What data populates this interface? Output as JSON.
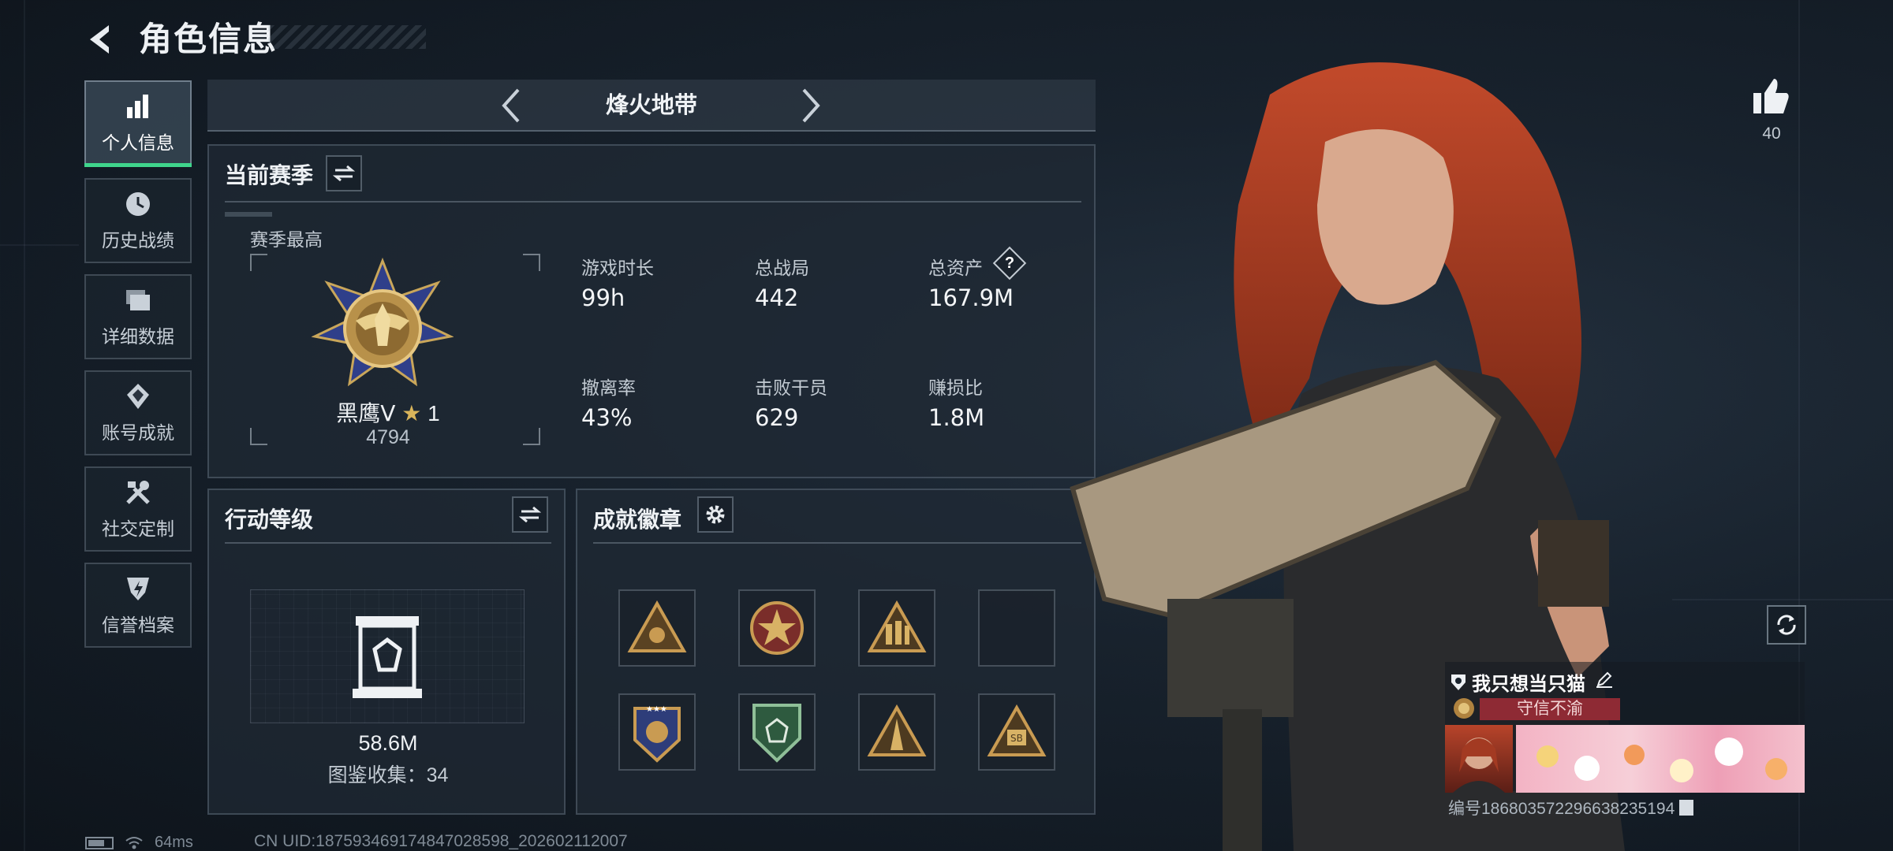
{
  "header": {
    "title": "角色信息"
  },
  "sidebar": {
    "items": [
      {
        "label": "个人信息",
        "icon": "bar-chart-icon",
        "active": true
      },
      {
        "label": "历史战绩",
        "icon": "history-clock-icon"
      },
      {
        "label": "详细数据",
        "icon": "stacked-cards-icon"
      },
      {
        "label": "账号成就",
        "icon": "achievement-ribbon-icon"
      },
      {
        "label": "社交定制",
        "icon": "tools-icon"
      },
      {
        "label": "信誉档案",
        "icon": "shield-lightning-icon"
      }
    ]
  },
  "mode": {
    "name": "烽火地带"
  },
  "season": {
    "title": "当前赛季",
    "best_label": "赛季最高",
    "rank_name": "黑鹰Ⅴ",
    "rank_stars": "1",
    "rank_points": "4794",
    "stats": [
      {
        "label": "游戏时长",
        "value": "99h"
      },
      {
        "label": "总战局",
        "value": "442"
      },
      {
        "label": "总资产",
        "value": "167.9M",
        "help": "?"
      },
      {
        "label": "撤离率",
        "value": "43%"
      },
      {
        "label": "击败干员",
        "value": "629"
      },
      {
        "label": "赚损比",
        "value": "1.8M"
      }
    ]
  },
  "action_level": {
    "title": "行动等级",
    "value": "58.6M",
    "collection": "图鉴收集：34"
  },
  "badges": {
    "title": "成就徽章",
    "slots": [
      "triangle-badge-icon",
      "star-medal-icon",
      "soldiers-badge-icon",
      "empty",
      "winged-medal-icon",
      "green-shield-icon",
      "tower-badge-icon",
      "sb-badge-icon"
    ]
  },
  "likes": {
    "count": "40"
  },
  "player": {
    "name": "我只想当只猫",
    "motto": "守信不渝",
    "id_text": "编号1868035722966382351​94"
  },
  "status": {
    "ping": "64ms",
    "uid": "CN UID:187593469174847028598_202602112007"
  },
  "colors": {
    "accent_green": "#3fd58c",
    "motto_red": "#8e2a34"
  }
}
